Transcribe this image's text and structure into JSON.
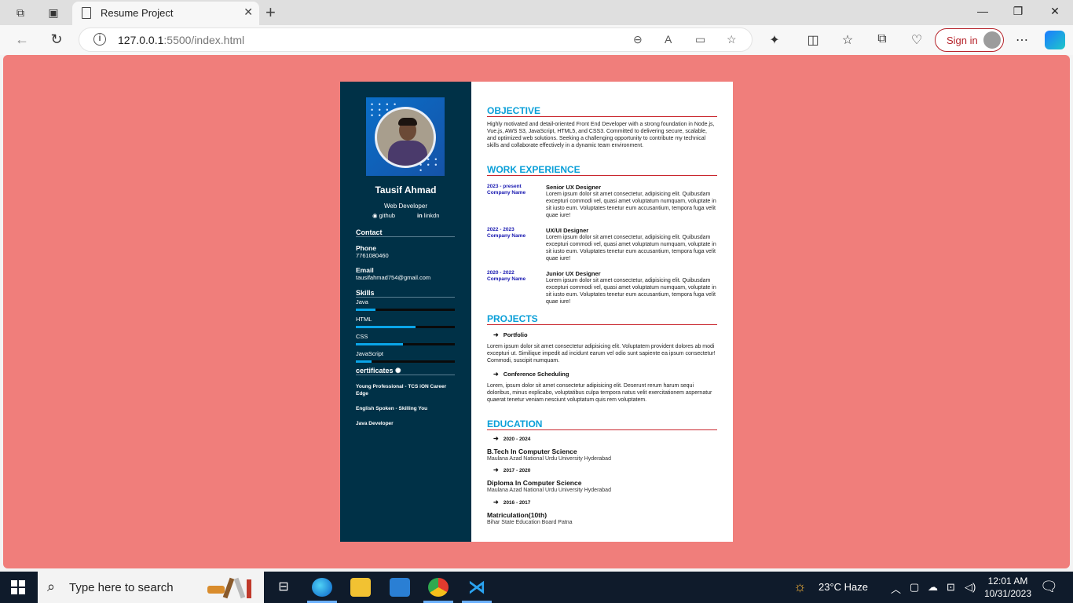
{
  "browser": {
    "tab_title": "Resume Project",
    "url_host": "127.0.0.1",
    "url_rest": ":5500/index.html",
    "signin_label": "Sign in"
  },
  "resume": {
    "name": "Tausif Ahmad",
    "role": "Web Developer",
    "social": [
      {
        "label": "github"
      },
      {
        "label": "linkdn"
      }
    ],
    "contact_heading": "Contact",
    "phone_label": "Phone",
    "phone": "7761080460",
    "email_label": "Email",
    "email": "tausifahmad754@gmail.com",
    "skills_heading": "Skills",
    "skills": [
      {
        "name": "Java",
        "level": 0.2
      },
      {
        "name": "HTML",
        "level": 0.6
      },
      {
        "name": "CSS",
        "level": 0.48
      },
      {
        "name": "JavaScript",
        "level": 0.16
      }
    ],
    "certificates_heading": "certificates",
    "certificates": [
      "Young Professional - TCS iON Career Edge",
      "English Spoken - Skilling You",
      "Java Developer"
    ],
    "objective_heading": "OBJECTIVE",
    "objective_text": "Highly motivated and detail-oriented Front End Developer with a strong foundation in Node.js, Vue.js, AWS S3, JavaScript, HTML5, and CSS3. Committed to delivering secure, scalable, and optimized web solutions. Seeking a challenging opportunity to contribute my technical skills and collaborate effectively in a dynamic team environment.",
    "work_heading": "WORK EXPERIENCE",
    "jobs": [
      {
        "date": "2023 - present",
        "company": "Company Name",
        "title": "Senior UX Designer",
        "desc": "Lorem ipsum dolor sit amet consectetur, adipisicing elit. Quibusdam excepturi commodi vel, quasi amet voluptatum numquam, voluptate in sit iusto eum. Voluptates tenetur eum accusantium, tempora fuga velit quae iure!"
      },
      {
        "date": "2022 - 2023",
        "company": "Company Name",
        "title": "UX/UI Designer",
        "desc": "Lorem ipsum dolor sit amet consectetur, adipisicing elit. Quibusdam excepturi commodi vel, quasi amet voluptatum numquam, voluptate in sit iusto eum. Voluptates tenetur eum accusantium, tempora fuga velit quae iure!"
      },
      {
        "date": "2020 - 2022",
        "company": "Company Name",
        "title": "Junior UX Designer",
        "desc": "Lorem ipsum dolor sit amet consectetur, adipisicing elit. Quibusdam excepturi commodi vel, quasi amet voluptatum numquam, voluptate in sit iusto eum. Voluptates tenetur eum accusantium, tempora fuga velit quae iure!"
      }
    ],
    "projects_heading": "PROJECTS",
    "projects": [
      {
        "title": "Portfolio",
        "desc": "Lorem ipsum dolor sit amet consectetur adipisicing elit. Voluptatem provident dolores ab modi excepturi ut. Similique impedit ad incidunt earum vel odio sunt sapiente ea ipsum consectetur! Commodi, suscipit numquam."
      },
      {
        "title": "Conference Scheduling",
        "desc": "Lorem, ipsum dolor sit amet consectetur adipisicing elit. Deserunt rerum harum sequi doloribus, minus explicabo, voluptatibus culpa tempora natus velit exercitationem aspernatur quaerat tenetur veniam nesciunt voluptatum quis rem voluptatem."
      }
    ],
    "education_heading": "EDUCATION",
    "education": [
      {
        "years": "2020 - 2024",
        "degree": "B.Tech In Computer Science",
        "school": "Maulana Azad National Urdu University Hyderabad"
      },
      {
        "years": "2017 - 2020",
        "degree": "Diploma In Computer Science",
        "school": "Maulana Azad National Urdu University Hyderabad"
      },
      {
        "years": "2016 - 2017",
        "degree": "Matriculation(10th)",
        "school": "Bihar State Education Board Patna"
      }
    ]
  },
  "taskbar": {
    "search_placeholder": "Type here to search",
    "weather": "23°C  Haze",
    "time": "12:01 AM",
    "date": "10/31/2023"
  },
  "colors": {
    "page_bg": "#f07e7b",
    "sidebar": "#003147",
    "accent": "#0a9fd8",
    "rule": "#c9272e"
  }
}
